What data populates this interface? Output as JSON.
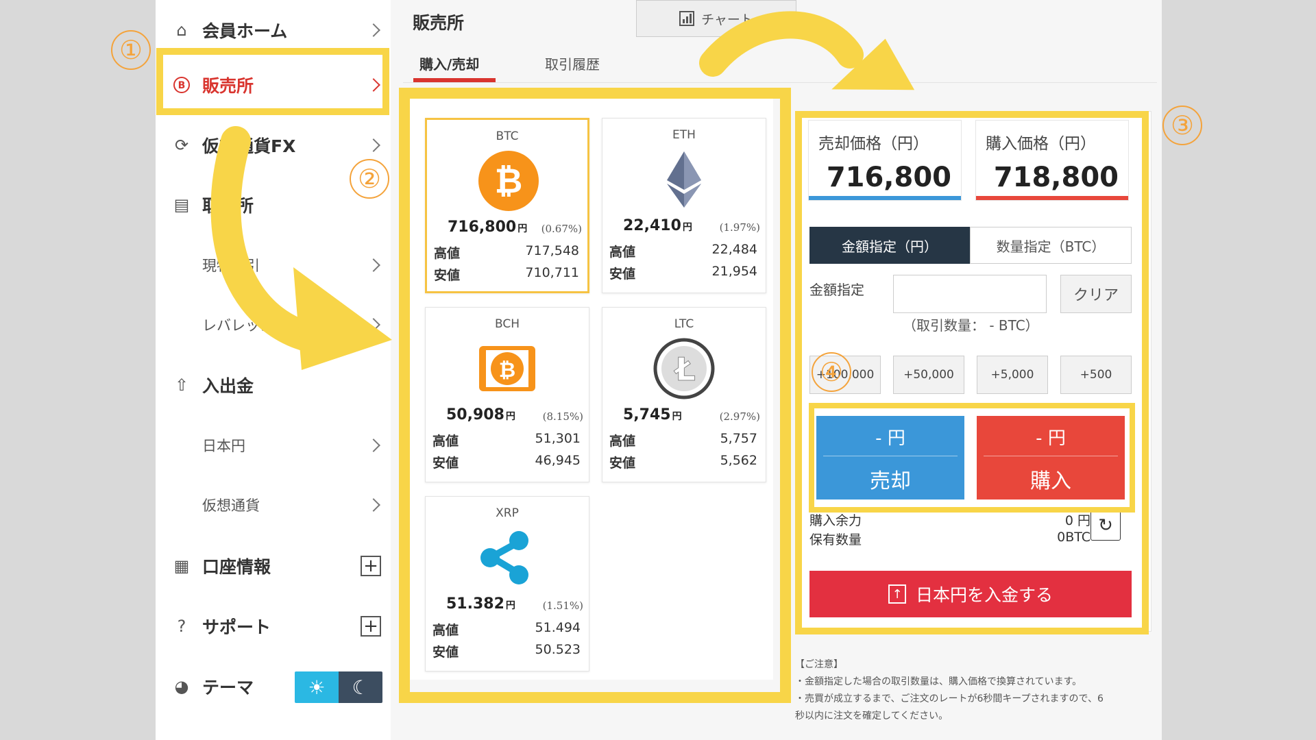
{
  "sidebar": {
    "items": [
      {
        "label": "会員ホーム",
        "icon": "home-icon",
        "trail": "chevron"
      },
      {
        "label": "販売所",
        "icon": "bitcoin-icon",
        "trail": "chevron",
        "active": true
      },
      {
        "label": "仮想通貨FX",
        "icon": "exchange-icon",
        "trail": "chevron"
      },
      {
        "label": "取引所",
        "icon": "building-icon",
        "trail": "none"
      },
      {
        "label": "現物取引",
        "icon": "",
        "trail": "chevron",
        "sub": true
      },
      {
        "label": "レバレッジ取引",
        "icon": "",
        "trail": "chevron",
        "sub": true
      },
      {
        "label": "入出金",
        "icon": "deposit-icon",
        "trail": "none"
      },
      {
        "label": "日本円",
        "icon": "",
        "trail": "chevron",
        "sub": true
      },
      {
        "label": "仮想通貨",
        "icon": "",
        "trail": "chevron",
        "sub": true
      },
      {
        "label": "口座情報",
        "icon": "account-icon",
        "trail": "plus"
      },
      {
        "label": "サポート",
        "icon": "help-icon",
        "trail": "plus"
      },
      {
        "label": "テーマ",
        "icon": "palette-icon",
        "trail": "toggle"
      }
    ]
  },
  "header": {
    "title": "販売所",
    "chart_button": "チャート"
  },
  "tabs": [
    {
      "label": "購入/売却",
      "active": true
    },
    {
      "label": "取引履歴",
      "active": false
    }
  ],
  "coins": [
    {
      "symbol": "BTC",
      "price": "716,800",
      "yen": "円",
      "change": "(0.67%)",
      "high_label": "高値",
      "high": "717,548",
      "low_label": "安値",
      "low": "710,711",
      "logo": "btc"
    },
    {
      "symbol": "ETH",
      "price": "22,410",
      "yen": "円",
      "change": "(1.97%)",
      "high_label": "高値",
      "high": "22,484",
      "low_label": "安値",
      "low": "21,954",
      "logo": "eth"
    },
    {
      "symbol": "BCH",
      "price": "50,908",
      "yen": "円",
      "change": "(8.15%)",
      "high_label": "高値",
      "high": "51,301",
      "low_label": "安値",
      "low": "46,945",
      "logo": "bch"
    },
    {
      "symbol": "LTC",
      "price": "5,745",
      "yen": "円",
      "change": "(2.97%)",
      "high_label": "高値",
      "high": "5,757",
      "low_label": "安値",
      "low": "5,562",
      "logo": "ltc"
    },
    {
      "symbol": "XRP",
      "price": "51.382",
      "yen": "円",
      "change": "(1.51%)",
      "high_label": "高値",
      "high": "51.494",
      "low_label": "安値",
      "low": "50.523",
      "logo": "xrp"
    }
  ],
  "trade": {
    "sell_price_label": "売却価格（円）",
    "sell_price": "716,800",
    "buy_price_label": "購入価格（円）",
    "buy_price": "718,800",
    "mode_amount": "金額指定（円）",
    "mode_quantity": "数量指定（BTC）",
    "amount_label": "金額指定",
    "amount_value": "",
    "clear": "クリア",
    "qty_note": "（取引数量： - BTC）",
    "increments": [
      "+100,000",
      "+50,000",
      "+5,000",
      "+500"
    ],
    "sell_amount": "- 円",
    "sell_label": "売却",
    "buy_amount": "- 円",
    "buy_label": "購入",
    "balance_label": "購入余力",
    "balance_value": "0 円",
    "holding_label": "保有数量",
    "holding_value": "0BTC",
    "deposit_label": "日本円を入金する"
  },
  "notes": {
    "title": "【ご注意】",
    "line1": "・金額指定した場合の取引数量は、購入価格で換算されています。",
    "line2": "・売買が成立するまで、ご注文のレートが6秒間キープされますので、6",
    "line3": "秒以内に注文を確定してください。"
  },
  "annotations": {
    "step1": "①",
    "step2": "②",
    "step3": "③",
    "step4": "④"
  },
  "colors": {
    "highlight": "#f8d548",
    "badge": "#f4a33b",
    "sell": "#3b97d9",
    "buy": "#e8473b",
    "active": "#d9352f",
    "deposit": "#e33040"
  }
}
